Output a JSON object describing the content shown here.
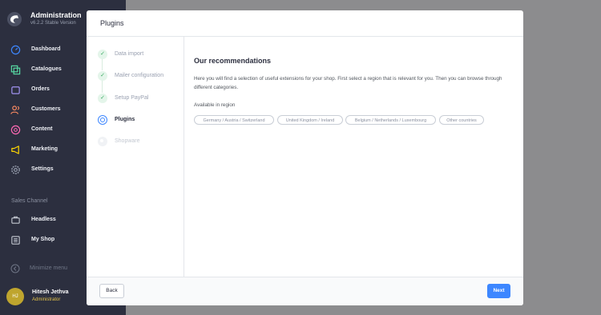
{
  "app": {
    "name": "Administration",
    "version": "v6.2.2 Stable Version",
    "logo_icon": "shopware-logo-icon"
  },
  "sidebar": {
    "items": [
      {
        "label": "Dashboard",
        "icon": "dashboard-icon",
        "color": "#3d87ff"
      },
      {
        "label": "Catalogues",
        "icon": "catalogues-icon",
        "color": "#57d9a3"
      },
      {
        "label": "Orders",
        "icon": "orders-icon",
        "color": "#a092f0"
      },
      {
        "label": "Customers",
        "icon": "customers-icon",
        "color": "#f88962"
      },
      {
        "label": "Content",
        "icon": "content-icon",
        "color": "#ff68b4"
      },
      {
        "label": "Marketing",
        "icon": "marketing-icon",
        "color": "#ffd700"
      },
      {
        "label": "Settings",
        "icon": "settings-icon",
        "color": "#9aa1b1"
      }
    ],
    "sales_channel_title": "Sales Channel",
    "sales_channels": [
      {
        "label": "Headless",
        "icon": "headless-channel-icon"
      },
      {
        "label": "My Shop",
        "icon": "storefront-channel-icon"
      }
    ],
    "minimize_label": "Minimize menu",
    "user": {
      "initials": "HJ",
      "name": "Hitesh Jethva",
      "role": "Administrator"
    }
  },
  "modal": {
    "title": "Plugins",
    "steps": [
      {
        "label": "Data import",
        "state": "done"
      },
      {
        "label": "Mailer configuration",
        "state": "done"
      },
      {
        "label": "Setup PayPal",
        "state": "done"
      },
      {
        "label": "Plugins",
        "state": "active"
      },
      {
        "label": "Shopware",
        "state": "todo"
      }
    ],
    "content": {
      "title": "Our recommendations",
      "description": "Here you will find a selection of useful extensions for your shop. First select a region that is relevant for you. Then you can browse through different categories.",
      "region_label": "Available in region",
      "regions": [
        "Germany / Austria / Switzerland",
        "United Kingdom / Ireland",
        "Belgium / Netherlands / Luxembourg",
        "Other countries"
      ]
    },
    "footer": {
      "back_label": "Back",
      "next_label": "Next"
    }
  },
  "colors": {
    "sidebar_bg": "#2c2f3f",
    "accent": "#3d87ff",
    "success": "#37a960"
  }
}
